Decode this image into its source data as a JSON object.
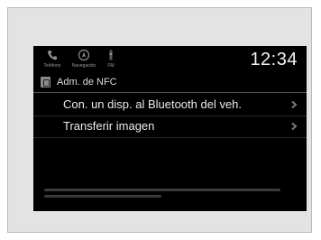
{
  "statusbar": {
    "items": [
      {
        "label": "Teléfono",
        "icon": "phone-icon"
      },
      {
        "label": "Navegación",
        "icon": "navigation-icon"
      },
      {
        "label": "FM",
        "icon": "radio-icon"
      }
    ],
    "clock": "12:34"
  },
  "header": {
    "title": "Adm. de NFC",
    "icon": "nfc-icon"
  },
  "menu": {
    "items": [
      {
        "label": "Con. un disp. al Bluetooth del veh."
      },
      {
        "label": "Transferir imagen"
      }
    ]
  },
  "colors": {
    "screen_bg": "#000000",
    "text": "#ececec",
    "frame_bg": "#e3e3e3"
  }
}
